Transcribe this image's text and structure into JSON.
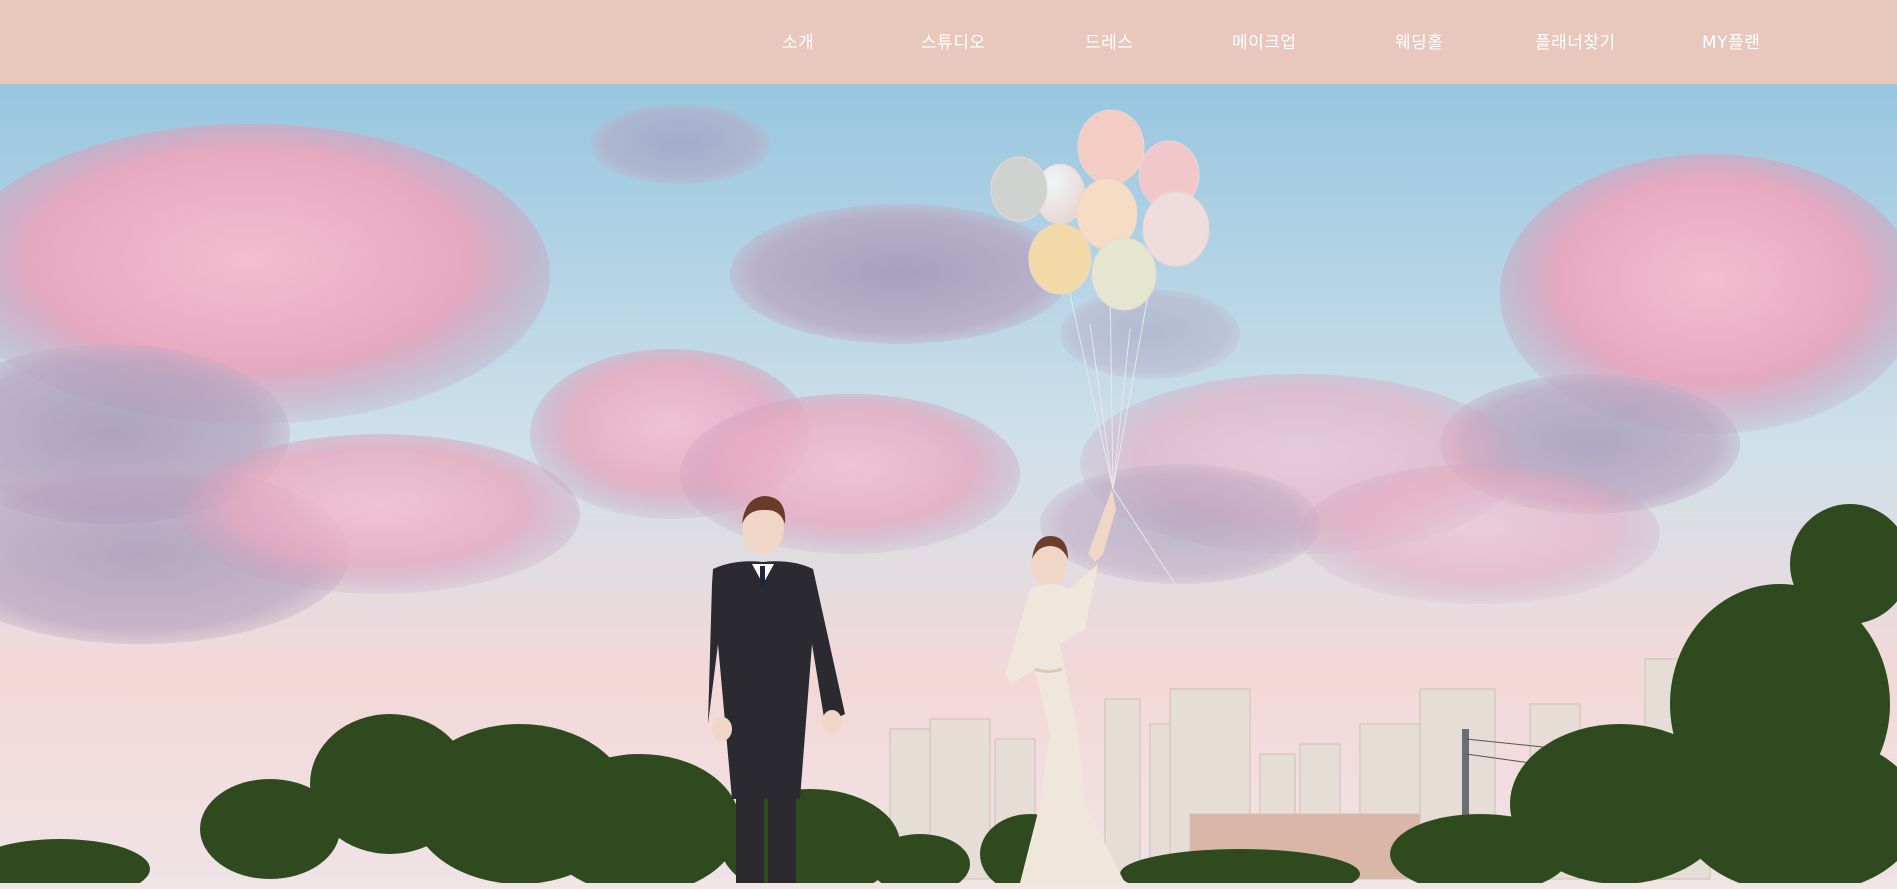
{
  "header": {
    "nav": [
      {
        "label": "소개"
      },
      {
        "label": "스튜디오"
      },
      {
        "label": "드레스"
      },
      {
        "label": "메이크업"
      },
      {
        "label": "웨딩홀"
      },
      {
        "label": "플래너찾기"
      },
      {
        "label": "MY플랜"
      }
    ]
  },
  "colors": {
    "header_bg": "#e8c7bd",
    "nav_text": "#ffffff",
    "sky_top": "#9fcbe3",
    "cloud_pink": "#efb3c7",
    "cloud_purple": "#9a8aaa",
    "tree": "#2f4a1e"
  }
}
